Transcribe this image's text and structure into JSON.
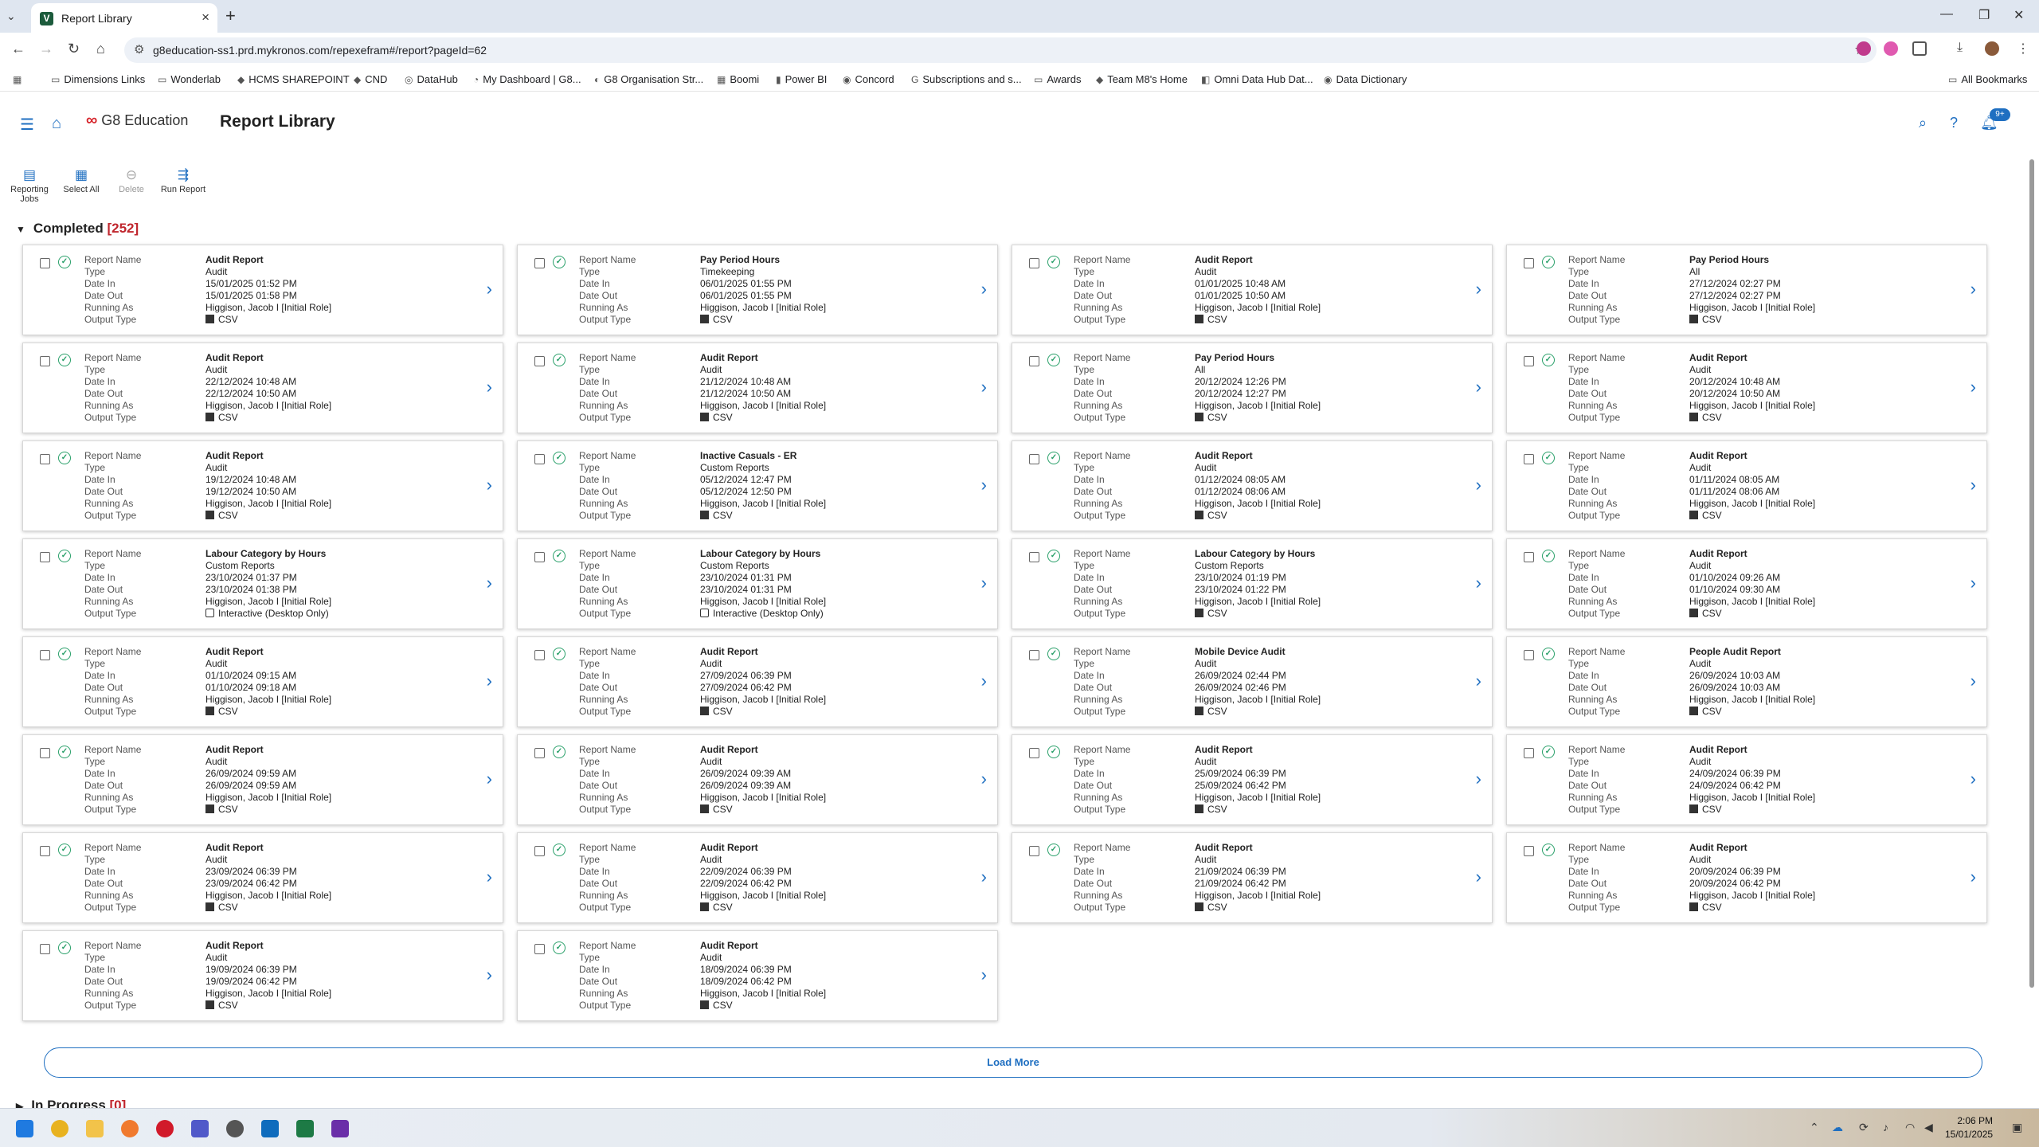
{
  "browser": {
    "tab_title": "Report Library",
    "url": "g8education-ss1.prd.mykronos.com/repexefram#/report?pageId=62",
    "bookmarks": [
      "Dimensions Links",
      "Wonderlab",
      "HCMS SHAREPOINT",
      "CND",
      "DataHub",
      "My Dashboard | G8...",
      "G8 Organisation Str...",
      "Boomi",
      "Power BI",
      "Concord",
      "Subscriptions and s...",
      "Awards",
      "Team M8's Home",
      "Omni Data Hub Dat...",
      "Data Dictionary"
    ],
    "all_bookmarks": "All Bookmarks"
  },
  "app": {
    "logo_text": "G8 Education",
    "title": "Report Library",
    "notification_count": "9+"
  },
  "toolbar": {
    "reporting_jobs": "Reporting Jobs",
    "select_all": "Select All",
    "delete": "Delete",
    "run_report": "Run Report"
  },
  "labels": {
    "report_name": "Report Name",
    "type": "Type",
    "date_in": "Date In",
    "date_out": "Date Out",
    "running_as": "Running As",
    "output_type": "Output Type"
  },
  "completed": {
    "label": "Completed",
    "count": "[252]"
  },
  "in_progress": {
    "label": "In Progress",
    "count": "[0]"
  },
  "load_more": "Load More",
  "reports": [
    {
      "name": "Audit Report",
      "type": "Audit",
      "date_in": "15/01/2025 01:52 PM",
      "date_out": "15/01/2025 01:58 PM",
      "running_as": "Higgison, Jacob I [Initial Role]",
      "output": "CSV"
    },
    {
      "name": "Pay Period Hours",
      "type": "Timekeeping",
      "date_in": "06/01/2025 01:55 PM",
      "date_out": "06/01/2025 01:55 PM",
      "running_as": "Higgison, Jacob I [Initial Role]",
      "output": "CSV"
    },
    {
      "name": "Audit Report",
      "type": "Audit",
      "date_in": "01/01/2025 10:48 AM",
      "date_out": "01/01/2025 10:50 AM",
      "running_as": "Higgison, Jacob I [Initial Role]",
      "output": "CSV"
    },
    {
      "name": "Pay Period Hours",
      "type": "All",
      "date_in": "27/12/2024 02:27 PM",
      "date_out": "27/12/2024 02:27 PM",
      "running_as": "Higgison, Jacob I [Initial Role]",
      "output": "CSV"
    },
    {
      "name": "Audit Report",
      "type": "Audit",
      "date_in": "22/12/2024 10:48 AM",
      "date_out": "22/12/2024 10:50 AM",
      "running_as": "Higgison, Jacob I [Initial Role]",
      "output": "CSV"
    },
    {
      "name": "Audit Report",
      "type": "Audit",
      "date_in": "21/12/2024 10:48 AM",
      "date_out": "21/12/2024 10:50 AM",
      "running_as": "Higgison, Jacob I [Initial Role]",
      "output": "CSV"
    },
    {
      "name": "Pay Period Hours",
      "type": "All",
      "date_in": "20/12/2024 12:26 PM",
      "date_out": "20/12/2024 12:27 PM",
      "running_as": "Higgison, Jacob I [Initial Role]",
      "output": "CSV"
    },
    {
      "name": "Audit Report",
      "type": "Audit",
      "date_in": "20/12/2024 10:48 AM",
      "date_out": "20/12/2024 10:50 AM",
      "running_as": "Higgison, Jacob I [Initial Role]",
      "output": "CSV"
    },
    {
      "name": "Audit Report",
      "type": "Audit",
      "date_in": "19/12/2024 10:48 AM",
      "date_out": "19/12/2024 10:50 AM",
      "running_as": "Higgison, Jacob I [Initial Role]",
      "output": "CSV"
    },
    {
      "name": "Inactive Casuals - ER",
      "type": "Custom Reports",
      "date_in": "05/12/2024 12:47 PM",
      "date_out": "05/12/2024 12:50 PM",
      "running_as": "Higgison, Jacob I [Initial Role]",
      "output": "CSV"
    },
    {
      "name": "Audit Report",
      "type": "Audit",
      "date_in": "01/12/2024 08:05 AM",
      "date_out": "01/12/2024 08:06 AM",
      "running_as": "Higgison, Jacob I [Initial Role]",
      "output": "CSV"
    },
    {
      "name": "Audit Report",
      "type": "Audit",
      "date_in": "01/11/2024 08:05 AM",
      "date_out": "01/11/2024 08:06 AM",
      "running_as": "Higgison, Jacob I [Initial Role]",
      "output": "CSV"
    },
    {
      "name": "Labour Category by Hours",
      "type": "Custom Reports",
      "date_in": "23/10/2024 01:37 PM",
      "date_out": "23/10/2024 01:38 PM",
      "running_as": "Higgison, Jacob I [Initial Role]",
      "output": "Interactive (Desktop Only)"
    },
    {
      "name": "Labour Category by Hours",
      "type": "Custom Reports",
      "date_in": "23/10/2024 01:31 PM",
      "date_out": "23/10/2024 01:31 PM",
      "running_as": "Higgison, Jacob I [Initial Role]",
      "output": "Interactive (Desktop Only)"
    },
    {
      "name": "Labour Category by Hours",
      "type": "Custom Reports",
      "date_in": "23/10/2024 01:19 PM",
      "date_out": "23/10/2024 01:22 PM",
      "running_as": "Higgison, Jacob I [Initial Role]",
      "output": "CSV"
    },
    {
      "name": "Audit Report",
      "type": "Audit",
      "date_in": "01/10/2024 09:26 AM",
      "date_out": "01/10/2024 09:30 AM",
      "running_as": "Higgison, Jacob I [Initial Role]",
      "output": "CSV"
    },
    {
      "name": "Audit Report",
      "type": "Audit",
      "date_in": "01/10/2024 09:15 AM",
      "date_out": "01/10/2024 09:18 AM",
      "running_as": "Higgison, Jacob I [Initial Role]",
      "output": "CSV"
    },
    {
      "name": "Audit Report",
      "type": "Audit",
      "date_in": "27/09/2024 06:39 PM",
      "date_out": "27/09/2024 06:42 PM",
      "running_as": "Higgison, Jacob I [Initial Role]",
      "output": "CSV"
    },
    {
      "name": "Mobile Device Audit",
      "type": "Audit",
      "date_in": "26/09/2024 02:44 PM",
      "date_out": "26/09/2024 02:46 PM",
      "running_as": "Higgison, Jacob I [Initial Role]",
      "output": "CSV"
    },
    {
      "name": "People Audit Report",
      "type": "Audit",
      "date_in": "26/09/2024 10:03 AM",
      "date_out": "26/09/2024 10:03 AM",
      "running_as": "Higgison, Jacob I [Initial Role]",
      "output": "CSV"
    },
    {
      "name": "Audit Report",
      "type": "Audit",
      "date_in": "26/09/2024 09:59 AM",
      "date_out": "26/09/2024 09:59 AM",
      "running_as": "Higgison, Jacob I [Initial Role]",
      "output": "CSV"
    },
    {
      "name": "Audit Report",
      "type": "Audit",
      "date_in": "26/09/2024 09:39 AM",
      "date_out": "26/09/2024 09:39 AM",
      "running_as": "Higgison, Jacob I [Initial Role]",
      "output": "CSV"
    },
    {
      "name": "Audit Report",
      "type": "Audit",
      "date_in": "25/09/2024 06:39 PM",
      "date_out": "25/09/2024 06:42 PM",
      "running_as": "Higgison, Jacob I [Initial Role]",
      "output": "CSV"
    },
    {
      "name": "Audit Report",
      "type": "Audit",
      "date_in": "24/09/2024 06:39 PM",
      "date_out": "24/09/2024 06:42 PM",
      "running_as": "Higgison, Jacob I [Initial Role]",
      "output": "CSV"
    },
    {
      "name": "Audit Report",
      "type": "Audit",
      "date_in": "23/09/2024 06:39 PM",
      "date_out": "23/09/2024 06:42 PM",
      "running_as": "Higgison, Jacob I [Initial Role]",
      "output": "CSV"
    },
    {
      "name": "Audit Report",
      "type": "Audit",
      "date_in": "22/09/2024 06:39 PM",
      "date_out": "22/09/2024 06:42 PM",
      "running_as": "Higgison, Jacob I [Initial Role]",
      "output": "CSV"
    },
    {
      "name": "Audit Report",
      "type": "Audit",
      "date_in": "21/09/2024 06:39 PM",
      "date_out": "21/09/2024 06:42 PM",
      "running_as": "Higgison, Jacob I [Initial Role]",
      "output": "CSV"
    },
    {
      "name": "Audit Report",
      "type": "Audit",
      "date_in": "20/09/2024 06:39 PM",
      "date_out": "20/09/2024 06:42 PM",
      "running_as": "Higgison, Jacob I [Initial Role]",
      "output": "CSV"
    },
    {
      "name": "Audit Report",
      "type": "Audit",
      "date_in": "19/09/2024 06:39 PM",
      "date_out": "19/09/2024 06:42 PM",
      "running_as": "Higgison, Jacob I [Initial Role]",
      "output": "CSV"
    },
    {
      "name": "Audit Report",
      "type": "Audit",
      "date_in": "18/09/2024 06:39 PM",
      "date_out": "18/09/2024 06:42 PM",
      "running_as": "Higgison, Jacob I [Initial Role]",
      "output": "CSV"
    }
  ],
  "taskbar": {
    "time": "2:06 PM",
    "date": "15/01/2025"
  },
  "colors": {
    "accent": "#1f6fc1",
    "success": "#2aa06a",
    "count_red": "#c0262d",
    "brand_red": "#d6232a"
  }
}
